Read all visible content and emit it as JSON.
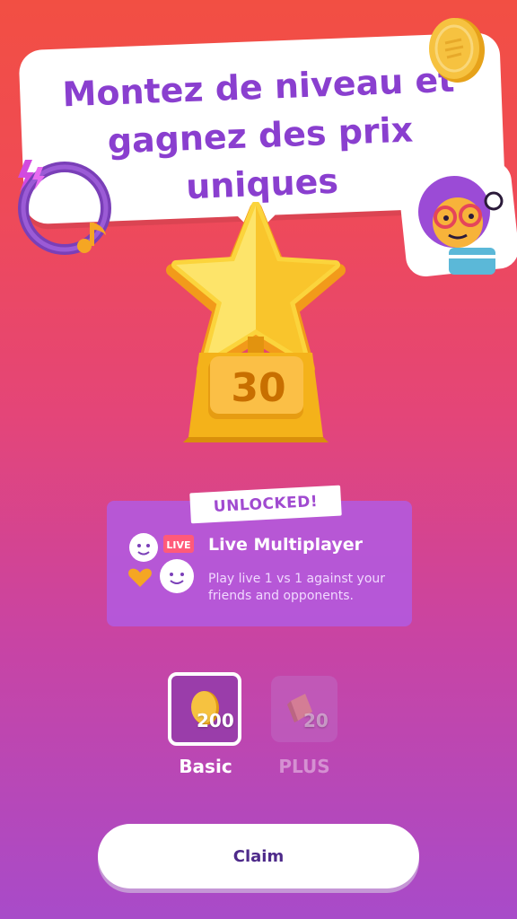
{
  "header": {
    "headline": "Montez de niveau et gagnez des prix uniques"
  },
  "level": {
    "number": "30"
  },
  "unlock": {
    "tag": "UNLOCKED!",
    "title": "Live Multiplayer",
    "description": "Play live 1 vs 1 against your friends and opponents.",
    "live_badge": "LIVE"
  },
  "rewards": [
    {
      "label": "Basic",
      "amount": "200",
      "icon": "coin-icon",
      "selected": true
    },
    {
      "label": "PLUS",
      "amount": "20",
      "icon": "gem-icon",
      "selected": false
    }
  ],
  "actions": {
    "claim_label": "Claim"
  },
  "colors": {
    "accent_purple": "#8a3fcf",
    "trophy_gold": "#f4b21a",
    "card_purple": "#b25ae2"
  }
}
